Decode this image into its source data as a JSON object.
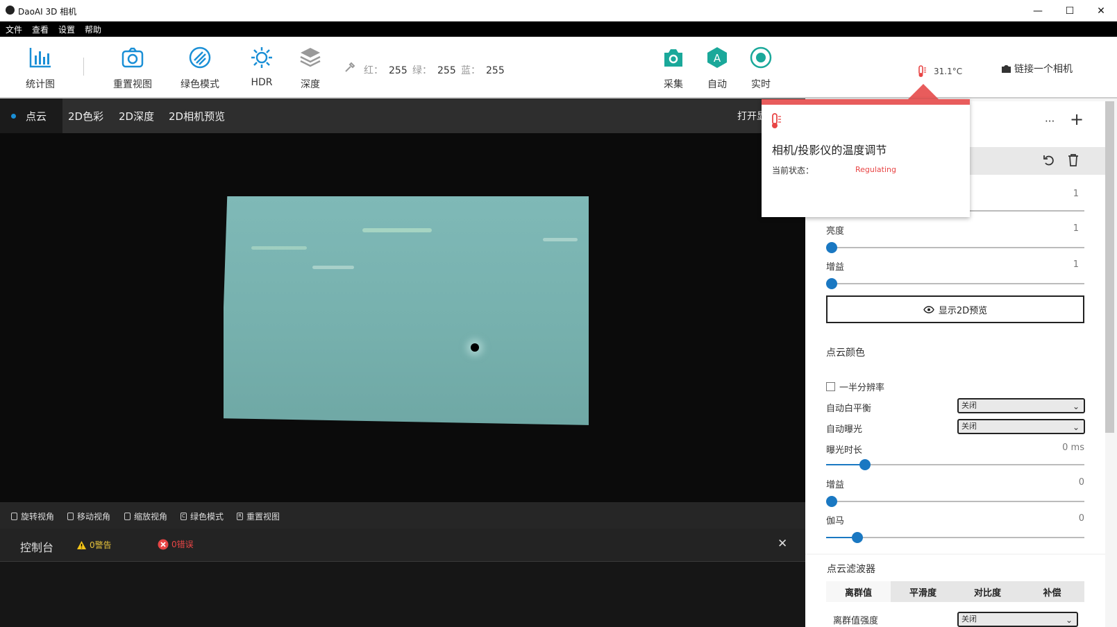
{
  "window": {
    "title": "DaoAI 3D 相机",
    "minimize": "—",
    "maximize": "☐",
    "close": "✕"
  },
  "menu": [
    "文件",
    "查看",
    "设置",
    "帮助"
  ],
  "toolbar": {
    "stats": "统计图",
    "reset_view": "重置视图",
    "green_mode": "绿色模式",
    "hdr": "HDR",
    "depth": "深度",
    "red_label": "红：",
    "red_value": "255",
    "green_label": "绿：",
    "green_value": "255",
    "blue_label": "蓝：",
    "blue_value": "255",
    "capture": "采集",
    "auto": "自动",
    "live": "实时",
    "temperature": "31.1°C",
    "connect_camera": "链接一个相机",
    "accent": "#1aa89a"
  },
  "tabs": {
    "items": [
      "点云",
      "2D色彩",
      "2D深度",
      "2D相机预览"
    ],
    "open_truncated": "打开显"
  },
  "viewbar": [
    "旋转视角",
    "移动视角",
    "缩放视角",
    "绿色模式",
    "重置视图"
  ],
  "console": {
    "title": "控制台",
    "warnings": "0警告",
    "errors": "0错误",
    "close": "✕"
  },
  "popup": {
    "title": "相机/投影仪的温度调节",
    "status_label": "当前状态：",
    "status_value": "Regulating",
    "status_color": "#e84545"
  },
  "panel": {
    "more": "···",
    "add": "+",
    "row_top_value": "1",
    "brightness_label": "亮度",
    "brightness_value": "1",
    "gain_label": "增益",
    "gain_value": "1",
    "preview_button": "显示2D预览",
    "pointcloud_color": "点云颜色",
    "half_resolution": "一半分辨率",
    "auto_wb": "自动白平衡",
    "auto_wb_value": "关闭",
    "auto_exposure": "自动曝光",
    "auto_exposure_value": "关闭",
    "exposure_time": "曝光时长",
    "exposure_time_value": "0 ms",
    "exposure_fraction": 0.15,
    "gain2_label": "增益",
    "gain2_value": "0",
    "gamma_label": "伽马",
    "gamma_value": "0",
    "gamma_fraction": 0.12,
    "filter_title": "点云滤波器",
    "filter_tabs": [
      "离群值",
      "平滑度",
      "对比度",
      "补偿"
    ],
    "outlier_strength": "离群值强度",
    "outlier_strength_value": "关闭"
  }
}
